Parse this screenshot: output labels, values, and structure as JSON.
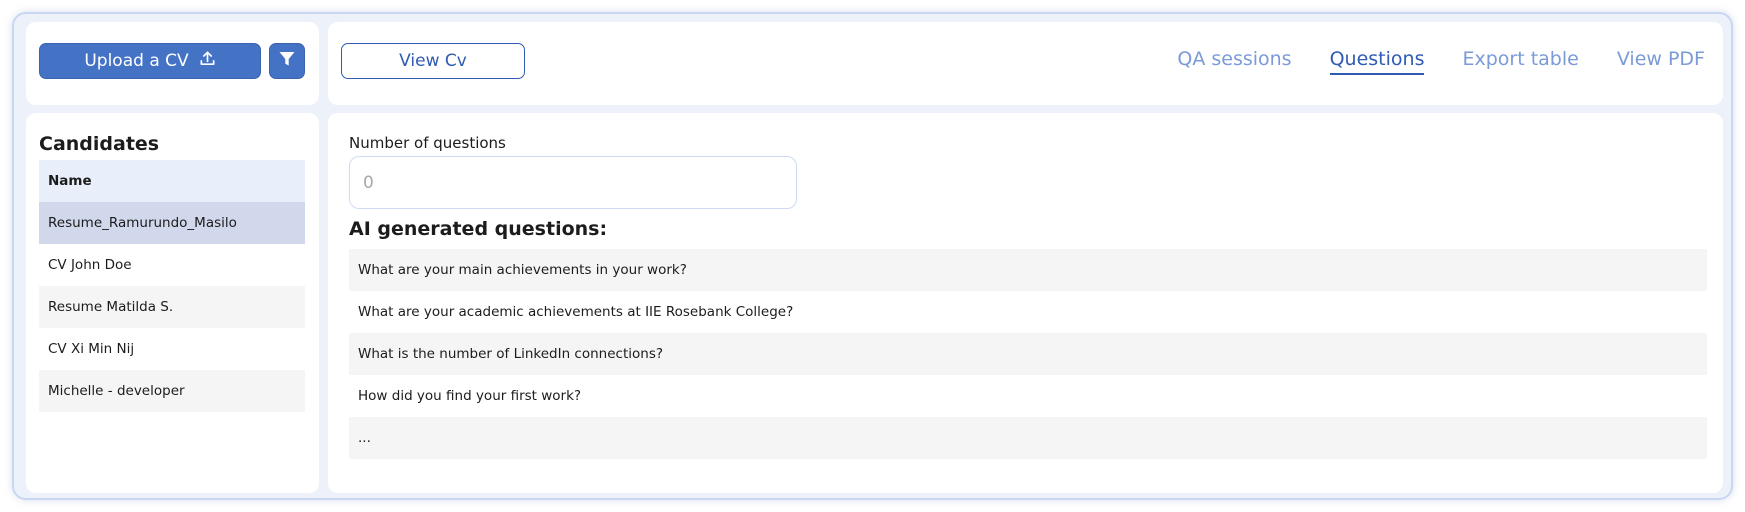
{
  "toolbar": {
    "upload_label": "Upload a CV",
    "view_cv_label": "View Cv"
  },
  "tabs": [
    {
      "label": "QA sessions",
      "active": false
    },
    {
      "label": "Questions",
      "active": true
    },
    {
      "label": "Export table",
      "active": false
    },
    {
      "label": "View PDF",
      "active": false
    }
  ],
  "candidates": {
    "title": "Candidates",
    "header": "Name",
    "rows": [
      "Resume_Ramurundo_Masilo",
      "CV John Doe",
      "Resume Matilda S.",
      "CV Xi Min Nij",
      "Michelle - developer"
    ],
    "selected_index": 0
  },
  "questions": {
    "number_label": "Number of questions",
    "number_placeholder": "0",
    "ai_title": "AI generated questions:",
    "items": [
      "What are your main achievements in your work?",
      "What are your academic achievements at IIE Rosebank College?",
      "What is the number of LinkedIn connections?",
      "How did you find your first work?",
      "..."
    ]
  },
  "colors": {
    "accent": "#4472c4",
    "accent_dark": "#2f5bb5",
    "tab_inactive": "#7a9ad8",
    "selected_row": "#d1d8ec",
    "header_row": "#e8effb"
  },
  "icons": {
    "upload": "upload-icon",
    "filter": "filter-icon"
  }
}
